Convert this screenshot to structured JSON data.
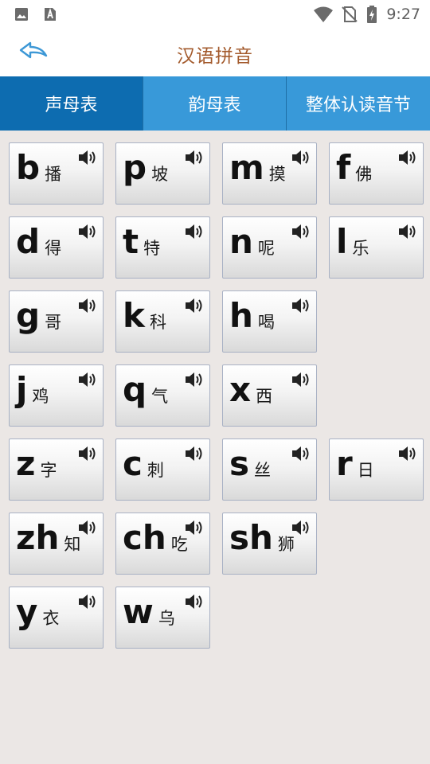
{
  "status_bar": {
    "time": "9:27",
    "icons": [
      "image-notification-icon",
      "a-notification-icon",
      "wifi-icon",
      "no-sim-icon",
      "battery-charging-icon"
    ]
  },
  "header": {
    "title": "汉语拼音",
    "back_icon": "back-arrow-icon",
    "title_color": "#a35a2c"
  },
  "tabs": [
    {
      "label": "声母表",
      "active": true
    },
    {
      "label": "韵母表",
      "active": false
    },
    {
      "label": "整体认读音节",
      "active": false
    }
  ],
  "colors": {
    "tab_bar": "#3899d9",
    "tab_active": "#0d6cb0",
    "background": "#ebe7e5"
  },
  "initials": [
    [
      {
        "letter": "b",
        "hanzi": "播"
      },
      {
        "letter": "p",
        "hanzi": "坡"
      },
      {
        "letter": "m",
        "hanzi": "摸"
      },
      {
        "letter": "f",
        "hanzi": "佛"
      }
    ],
    [
      {
        "letter": "d",
        "hanzi": "得"
      },
      {
        "letter": "t",
        "hanzi": "特"
      },
      {
        "letter": "n",
        "hanzi": "呢"
      },
      {
        "letter": "l",
        "hanzi": "乐"
      }
    ],
    [
      {
        "letter": "g",
        "hanzi": "哥"
      },
      {
        "letter": "k",
        "hanzi": "科"
      },
      {
        "letter": "h",
        "hanzi": "喝"
      }
    ],
    [
      {
        "letter": "j",
        "hanzi": "鸡"
      },
      {
        "letter": "q",
        "hanzi": "气"
      },
      {
        "letter": "x",
        "hanzi": "西"
      }
    ],
    [
      {
        "letter": "z",
        "hanzi": "字"
      },
      {
        "letter": "c",
        "hanzi": "刺"
      },
      {
        "letter": "s",
        "hanzi": "丝"
      },
      {
        "letter": "r",
        "hanzi": "日"
      }
    ],
    [
      {
        "letter": "zh",
        "hanzi": "知"
      },
      {
        "letter": "ch",
        "hanzi": "吃"
      },
      {
        "letter": "sh",
        "hanzi": "狮"
      }
    ],
    [
      {
        "letter": "y",
        "hanzi": "衣"
      },
      {
        "letter": "w",
        "hanzi": "乌"
      }
    ]
  ]
}
